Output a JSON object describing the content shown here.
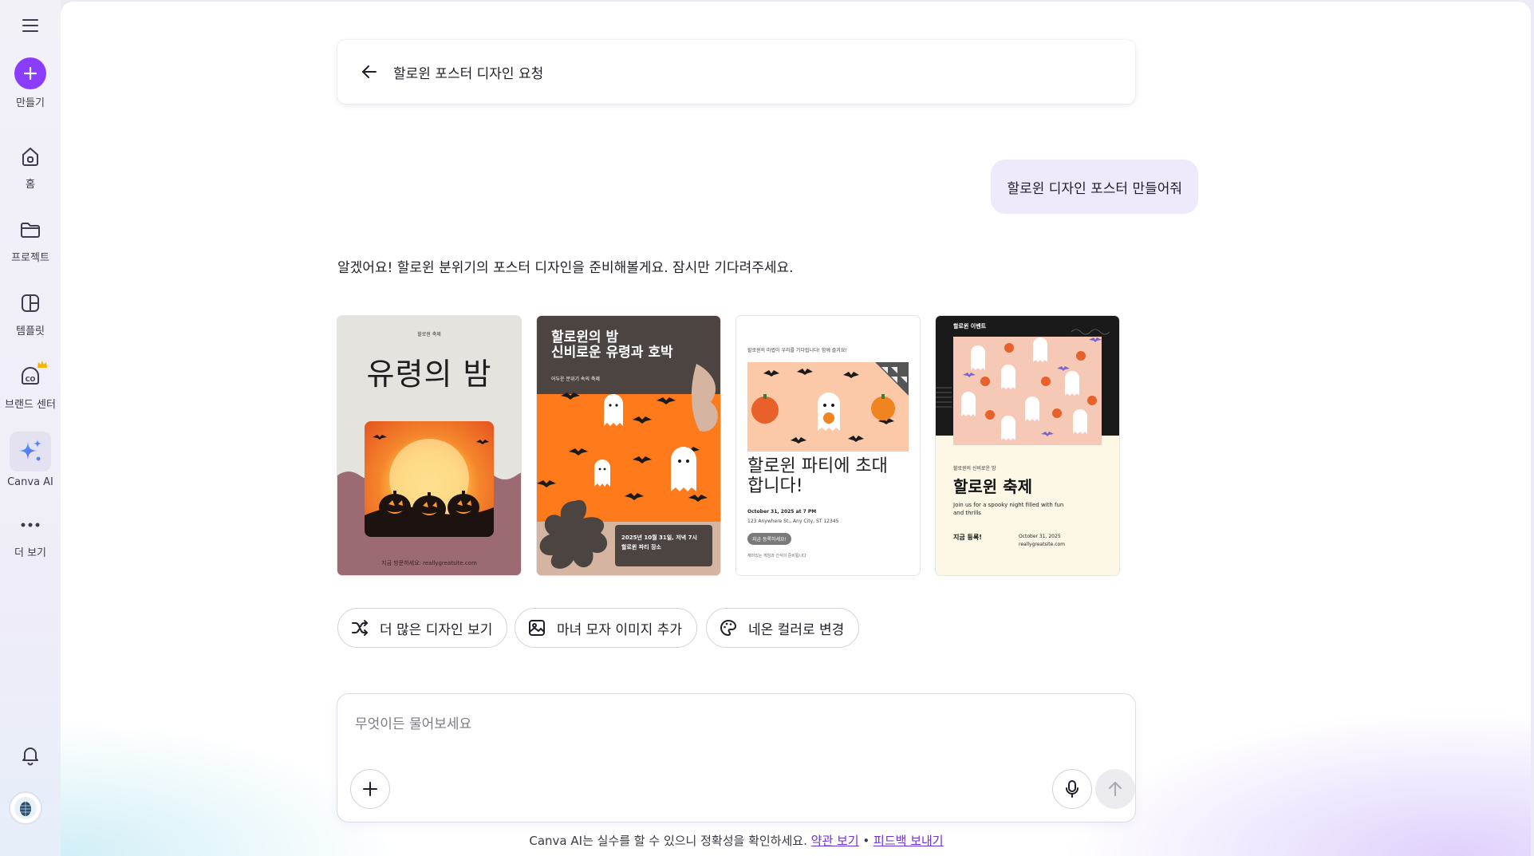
{
  "sidebar": {
    "items": [
      {
        "label": "만들기",
        "icon": "plus-icon"
      },
      {
        "label": "홈",
        "icon": "home-icon"
      },
      {
        "label": "프로젝트",
        "icon": "folder-icon"
      },
      {
        "label": "템플릿",
        "icon": "template-icon"
      },
      {
        "label": "브랜드 센터",
        "icon": "brand-icon"
      },
      {
        "label": "Canva AI",
        "icon": "sparkle-icon"
      },
      {
        "label": "더 보기",
        "icon": "more-icon"
      }
    ]
  },
  "header": {
    "title": "할로윈 포스터 디자인 요청"
  },
  "chat": {
    "user_message": "할로윈 디자인 포스터 만들어줘",
    "ai_message": "알겠어요! 할로윈 분위기의 포스터 디자인을 준비해볼게요. 잠시만 기다려주세요."
  },
  "designs": {
    "card1": {
      "tag": "할로윈 축제",
      "title": "유령의 밤",
      "footer": "지금 방문하세요: reallygreatsite.com"
    },
    "card2": {
      "title_line1": "할로윈의 밤",
      "title_line2": "신비로운 유령과 호박",
      "subtitle": "어두운 분위기 속의 축제",
      "date_line1": "2025년 10월 31일, 저녁 7시",
      "date_line2": "할로윈 파티 장소"
    },
    "card3": {
      "intro": "할로윈의 마법이 우리를 기다립니다! 함께 즐겨요!",
      "title_line1": "할로윈 파티에 초대",
      "title_line2": "합니다!",
      "date": "October 31, 2025 at 7 PM",
      "address": "123 Anywhere St., Any City, ST 12345",
      "cta": "지금 등록하세요!",
      "note": "재미있는 게임과 간식이 준비됩니다"
    },
    "card4": {
      "tag": "할로윈 이벤트",
      "subtitle": "할로윈의 신비로운 밤",
      "title": "할로윈 축제",
      "desc": "Join us for a spooky night filled with fun and thrills",
      "register": "지금 등록!",
      "date": "October 31, 2025",
      "site": "reallygreatsite.com"
    }
  },
  "suggestions": [
    {
      "label": "더 많은 디자인 보기",
      "icon": "shuffle-icon"
    },
    {
      "label": "마녀 모자 이미지 추가",
      "icon": "image-icon"
    },
    {
      "label": "네온 컬러로 변경",
      "icon": "palette-icon"
    }
  ],
  "composer": {
    "placeholder": "무엇이든 물어보세요"
  },
  "footer": {
    "disclaimer": "Canva AI는 실수를 할 수 있으니 정확성을 확인하세요.",
    "terms_link": "약관 보기",
    "separator": "•",
    "feedback_link": "피드백 보내기"
  },
  "colors": {
    "accent": "#8b3dff",
    "bubble": "#efe9fc",
    "link": "#6a2fe0"
  }
}
